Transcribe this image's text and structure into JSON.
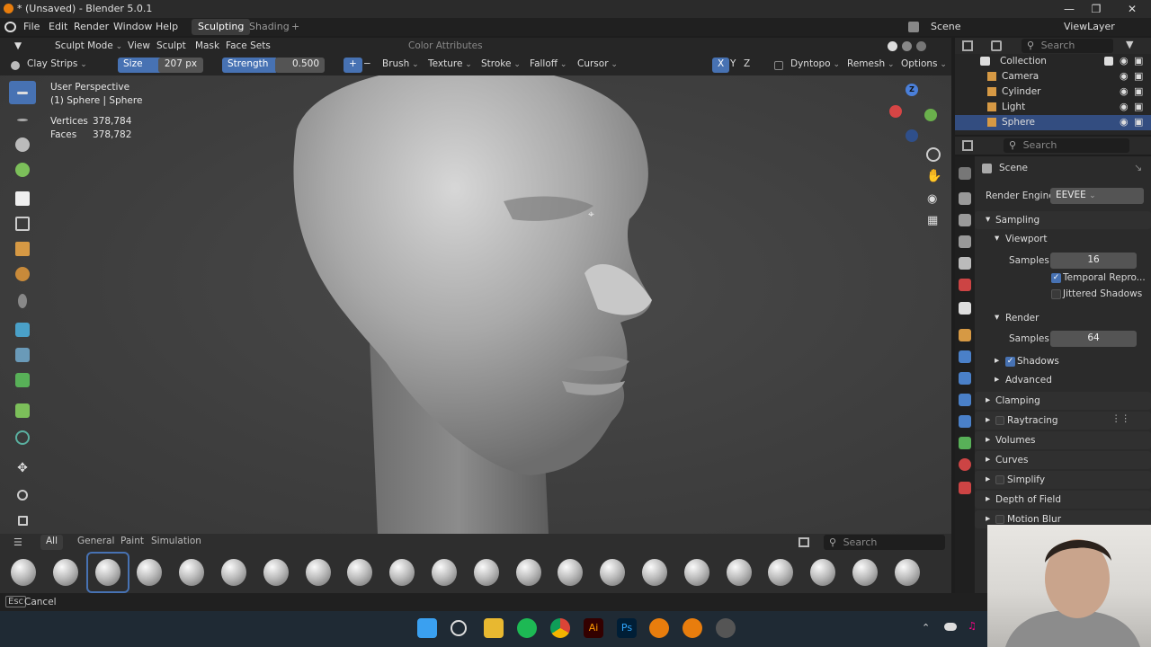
{
  "window": {
    "title": "* (Unsaved) - Blender 5.0.1"
  },
  "menubar": {
    "items": [
      "File",
      "Edit",
      "Render",
      "Window",
      "Help"
    ],
    "tabs": [
      "Sculpting",
      "Shading"
    ],
    "scene": "Scene",
    "view_layer": "ViewLayer"
  },
  "viewport_header": {
    "mode": "Sculpt Mode",
    "menus": [
      "View",
      "Sculpt",
      "Mask",
      "Face Sets"
    ],
    "color_attributes": "Color Attributes"
  },
  "tool_header": {
    "brush_name": "Clay Strips",
    "size_label": "Size",
    "size_value": "207 px",
    "strength_label": "Strength",
    "strength_value": "0.500",
    "menus": [
      "Brush",
      "Texture",
      "Stroke",
      "Falloff",
      "Cursor"
    ],
    "axes": [
      "X",
      "Y",
      "Z"
    ],
    "dyntopo": "Dyntopo",
    "remesh": "Remesh",
    "options": "Options"
  },
  "overlay": {
    "view": "User Perspective",
    "object": "(1) Sphere | Sphere",
    "vertices_label": "Vertices",
    "vertices_value": "378,784",
    "faces_label": "Faces",
    "faces_value": "378,782"
  },
  "gizmo": {
    "z": "Z"
  },
  "shelf": {
    "tabs": [
      "All",
      "General",
      "Paint",
      "Simulation"
    ],
    "search_placeholder": "Search",
    "brush_count": 22,
    "selected_index": 2
  },
  "statusbar": {
    "key": "Esc",
    "action": "Cancel"
  },
  "outliner": {
    "search_placeholder": "Search",
    "collection": "Collection",
    "items": [
      "Camera",
      "Cylinder",
      "Light",
      "Sphere"
    ],
    "selected": "Sphere"
  },
  "properties": {
    "search_placeholder": "Search",
    "context": "Scene",
    "render_engine_label": "Render Engine",
    "render_engine": "EEVEE",
    "sampling": "Sampling",
    "viewport": "Viewport",
    "viewport_samples_label": "Samples",
    "viewport_samples": "16",
    "temporal": "Temporal Repro...",
    "temporal_checked": true,
    "jittered": "Jittered Shadows",
    "jittered_checked": false,
    "render": "Render",
    "render_samples_label": "Samples",
    "render_samples": "64",
    "shadows": "Shadows",
    "shadows_checked": true,
    "advanced": "Advanced",
    "panels": [
      "Clamping",
      "Raytracing",
      "Volumes",
      "Curves",
      "Simplify",
      "Depth of Field",
      "Motion Blur"
    ]
  },
  "colors": {
    "accent": "#4772b3",
    "selected_row": "#334d80"
  }
}
